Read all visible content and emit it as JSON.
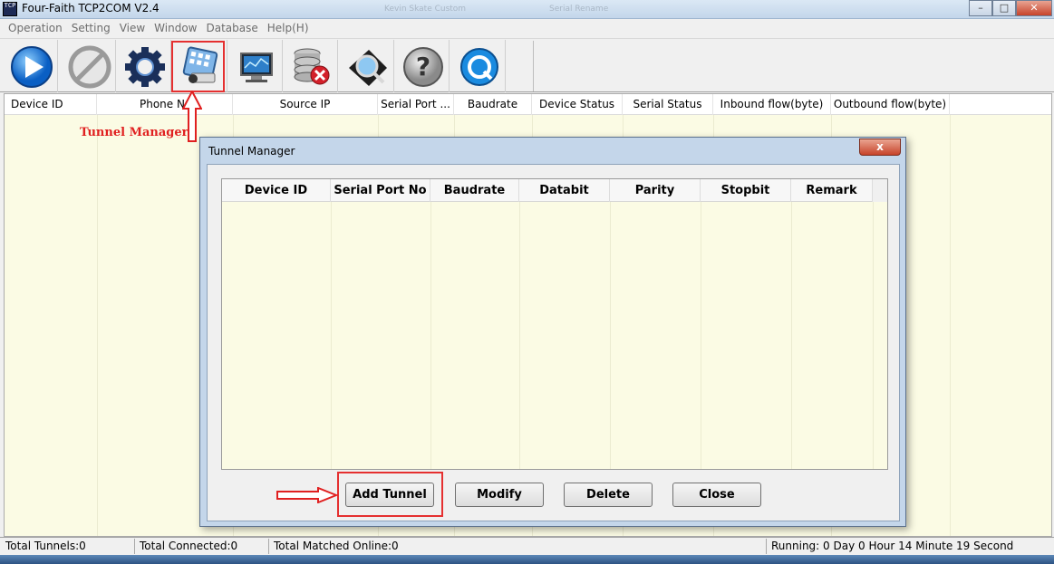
{
  "window": {
    "title": "Four-Faith TCP2COM V2.4",
    "app_icon_text": "TCP",
    "ghost_left": "Kevin Skate Custom",
    "ghost_right": "Serial Rename"
  },
  "menu": [
    "Operation",
    "Setting",
    "View",
    "Window",
    "Database",
    "Help(H)"
  ],
  "toolbar": {
    "buttons": [
      {
        "name": "start-button",
        "icon": "play-icon"
      },
      {
        "name": "stop-button",
        "icon": "stop-icon"
      },
      {
        "name": "settings-button",
        "icon": "gear-icon"
      },
      {
        "name": "tunnel-manager-button",
        "icon": "tunnel-manager-icon"
      },
      {
        "name": "monitor-button",
        "icon": "monitor-icon"
      },
      {
        "name": "delete-database-button",
        "icon": "database-delete-icon"
      },
      {
        "name": "search-button",
        "icon": "magnifier-icon"
      },
      {
        "name": "help-button",
        "icon": "question-icon"
      },
      {
        "name": "about-button",
        "icon": "refresh-icon"
      }
    ]
  },
  "main_list": {
    "columns": [
      "Device ID",
      "Phone No",
      "Source IP",
      "Serial Port ...",
      "Baudrate",
      "Device Status",
      "Serial Status",
      "Inbound flow(byte)",
      "Outbound flow(byte)"
    ]
  },
  "annotation": {
    "tunnel_manager_label": "Tunnel Manager",
    "color": "#e02020"
  },
  "dialog": {
    "title": "Tunnel Manager",
    "close_label": "x",
    "columns": [
      "Device ID",
      "Serial Port No",
      "Baudrate",
      "Databit",
      "Parity",
      "Stopbit",
      "Remark"
    ],
    "buttons": {
      "add": "Add Tunnel",
      "modify": "Modify",
      "delete": "Delete",
      "close": "Close"
    }
  },
  "status": {
    "total_tunnels": "Total Tunnels:0",
    "total_connected": "Total Connected:0",
    "total_matched": "Total Matched Online:0",
    "running": "Running: 0 Day  0 Hour 14 Minute 19 Second"
  },
  "colors": {
    "list_background": "#fbfbe4",
    "dialog_frame": "#c4d6ea",
    "annotation_red": "#e53030"
  }
}
